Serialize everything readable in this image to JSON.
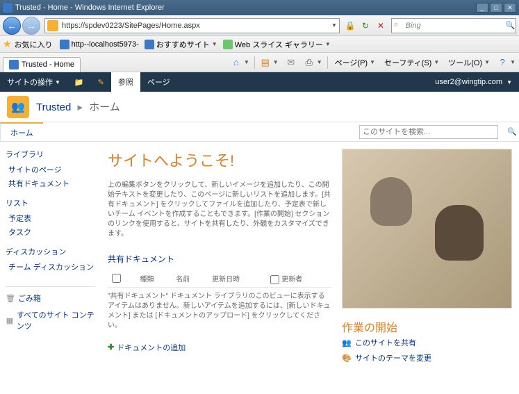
{
  "window": {
    "title": "Trusted - Home - Windows Internet Explorer"
  },
  "nav": {
    "url": "https://spdev0223/SitePages/Home.aspx",
    "search_provider": "Bing"
  },
  "favorites": {
    "label": "お気に入り",
    "items": [
      {
        "label": "http--localhost5973-"
      },
      {
        "label": "おすすめサイト"
      },
      {
        "label": "Web スライス ギャラリー"
      }
    ]
  },
  "tabs": {
    "active": "Trusted - Home"
  },
  "commands": {
    "page": "ページ(P)",
    "safety": "セーフティ(S)",
    "tools": "ツール(O)"
  },
  "ribbon": {
    "site_actions": "サイトの操作",
    "browse": "参照",
    "page": "ページ",
    "user": "user2@wingtip.com"
  },
  "breadcrumb": {
    "site": "Trusted",
    "page": "ホーム"
  },
  "topnav": {
    "home": "ホーム",
    "search_placeholder": "このサイトを検索..."
  },
  "leftnav": {
    "library_header": "ライブラリ",
    "library_items": [
      "サイトのページ",
      "共有ドキュメント"
    ],
    "list_header": "リスト",
    "list_items": [
      "予定表",
      "タスク"
    ],
    "discussion_header": "ディスカッション",
    "discussion_items": [
      "チーム ディスカッション"
    ],
    "recycle": "ごみ箱",
    "all_content": "すべてのサイト コンテンツ"
  },
  "main": {
    "welcome": "サイトへようこそ!",
    "intro": "上の編集ボタンをクリックして、新しいイメージを追加したり、この開始テキストを変更したり、このページに新しいリストを追加します。[共有ドキュメント] をクリックしてファイルを追加したり、予定表で新しいチーム イベントを作成することもできます。[作業の開始] セクションのリンクを使用すると、サイトを共有したり、外観をカスタマイズできます。",
    "doclib_title": "共有ドキュメント",
    "table_headers": {
      "type": "種類",
      "name": "名前",
      "modified": "更新日時",
      "modifiedby": "更新者"
    },
    "empty": "\"共有ドキュメント\" ドキュメント ライブラリのこのビューに表示するアイテムはありません。新しいアイテムを追加するには、[新しいドキュメント] または [ドキュメントのアップロード] をクリックしてください。",
    "add_doc": "ドキュメントの追加"
  },
  "getting_started": {
    "title": "作業の開始",
    "share": "このサイトを共有",
    "theme": "サイトのテーマを変更"
  }
}
